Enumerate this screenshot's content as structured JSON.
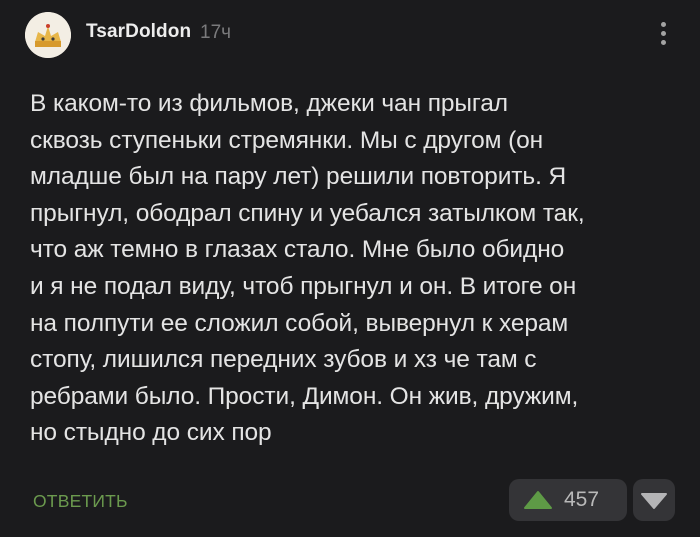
{
  "comment": {
    "author": "TsarDoldon",
    "time": "17ч",
    "text": "В каком-то из фильмов, джеки чан прыгал\nсквозь ступеньки стремянки. Мы с другом (он\nмладше был на пару лет) решили повторить. Я\nпрыгнул, ободрал спину и уебался затылком так,\nчто аж темно в глазах стало. Мне было обидно\nи я не подал виду, чтоб прыгнул и он. В итоге он\nна полпути ее сложил собой, вывернул к херам\nстопу, лишился передних зубов и хз че там с\nребрами было. Прости, Димон. Он жив, дружим,\nно стыдно до сих пор",
    "reply_label": "ОТВЕТИТЬ",
    "rating": "457"
  },
  "icons": {
    "avatar": "avatar-image",
    "more": "more-vertical-icon",
    "upvote": "upvote-triangle-icon",
    "downvote": "downvote-triangle-icon"
  },
  "colors": {
    "background": "#1b1b1d",
    "text": "#e4e4e4",
    "muted": "#7a7a7c",
    "reply_link": "#6b9a4e",
    "upvote": "#5e9a46",
    "vote_box": "#343437"
  }
}
